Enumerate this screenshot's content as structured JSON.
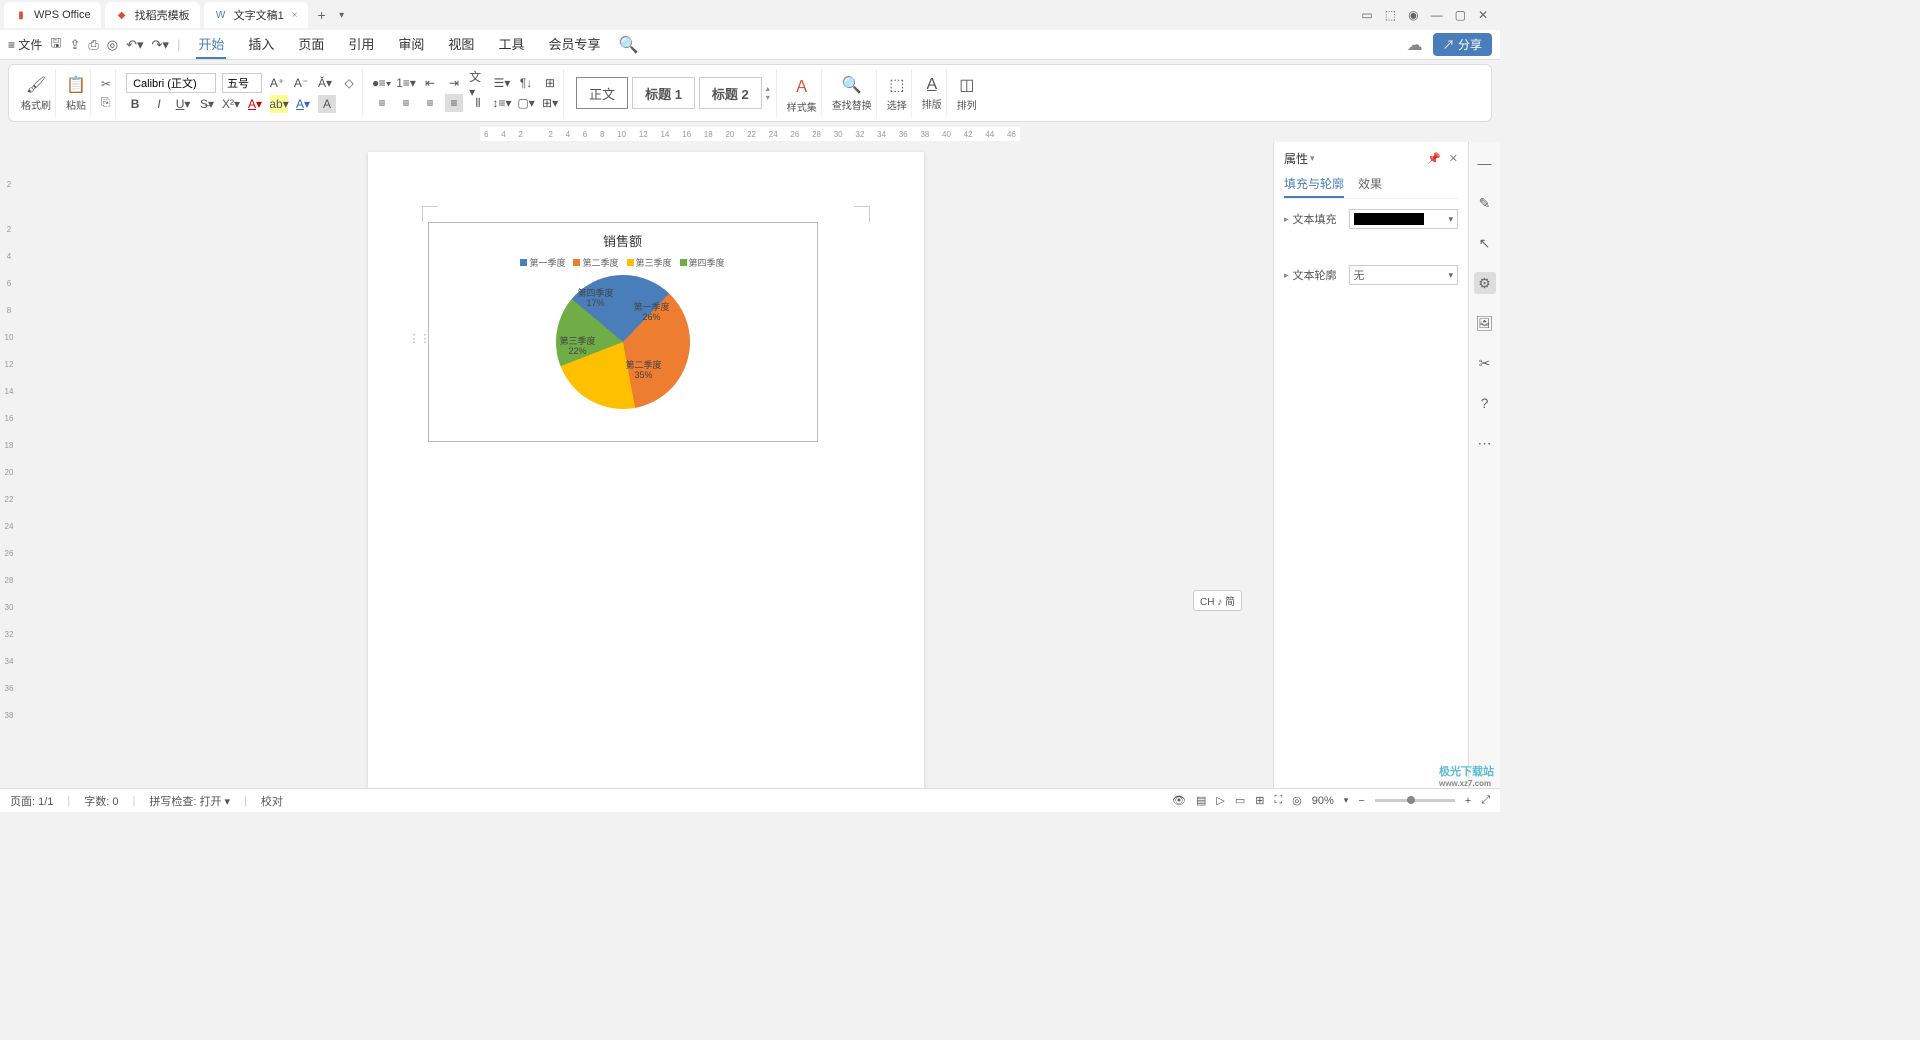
{
  "tabs": {
    "app": "WPS Office",
    "template": "找稻壳模板",
    "doc": "文字文稿1"
  },
  "menubar": {
    "file": "文件",
    "items": [
      "开始",
      "插入",
      "页面",
      "引用",
      "审阅",
      "视图",
      "工具",
      "会员专享"
    ],
    "share": "分享"
  },
  "ribbon": {
    "format_painter": "格式刷",
    "paste": "粘贴",
    "font": "Calibri (正文)",
    "size": "五号",
    "styles": {
      "normal": "正文",
      "h1": "标题 1",
      "h2": "标题 2"
    },
    "style_set": "样式集",
    "find_replace": "查找替换",
    "select": "选择",
    "layout": "排版",
    "arrange": "排列"
  },
  "ruler_h": [
    "6",
    "4",
    "2",
    "",
    "2",
    "4",
    "6",
    "8",
    "10",
    "12",
    "14",
    "16",
    "18",
    "20",
    "22",
    "24",
    "26",
    "28",
    "30",
    "32",
    "34",
    "36",
    "38",
    "40",
    "42",
    "44",
    "46"
  ],
  "ruler_v": [
    "",
    "2",
    "",
    "2",
    "4",
    "6",
    "8",
    "10",
    "12",
    "14",
    "16",
    "18",
    "20",
    "22",
    "24",
    "26",
    "28",
    "30",
    "32",
    "34",
    "36",
    "38"
  ],
  "panel": {
    "title": "属性",
    "tabs": {
      "fill": "填充与轮廓",
      "effect": "效果"
    },
    "text_fill": "文本填充",
    "text_outline": "文本轮廓",
    "outline_value": "无"
  },
  "ime": "CH ♪ 简",
  "status": {
    "page": "页面: 1/1",
    "words": "字数: 0",
    "spell": "拼写检查: 打开",
    "proof": "校对",
    "zoom": "90%"
  },
  "watermark": {
    "name": "极光下载站",
    "url": "www.xz7.com"
  },
  "chart_data": {
    "type": "pie",
    "title": "销售额",
    "series_name": [
      "第一季度",
      "第二季度",
      "第三季度",
      "第四季度"
    ],
    "values": [
      26,
      35,
      22,
      17
    ],
    "labels": [
      {
        "name": "第一季度",
        "pct": "26%"
      },
      {
        "name": "第二季度",
        "pct": "35%"
      },
      {
        "name": "第三季度",
        "pct": "22%"
      },
      {
        "name": "第四季度",
        "pct": "17%"
      }
    ],
    "colors": [
      "#4a7ebb",
      "#ed7d31",
      "#ffc000",
      "#70ad47"
    ]
  }
}
